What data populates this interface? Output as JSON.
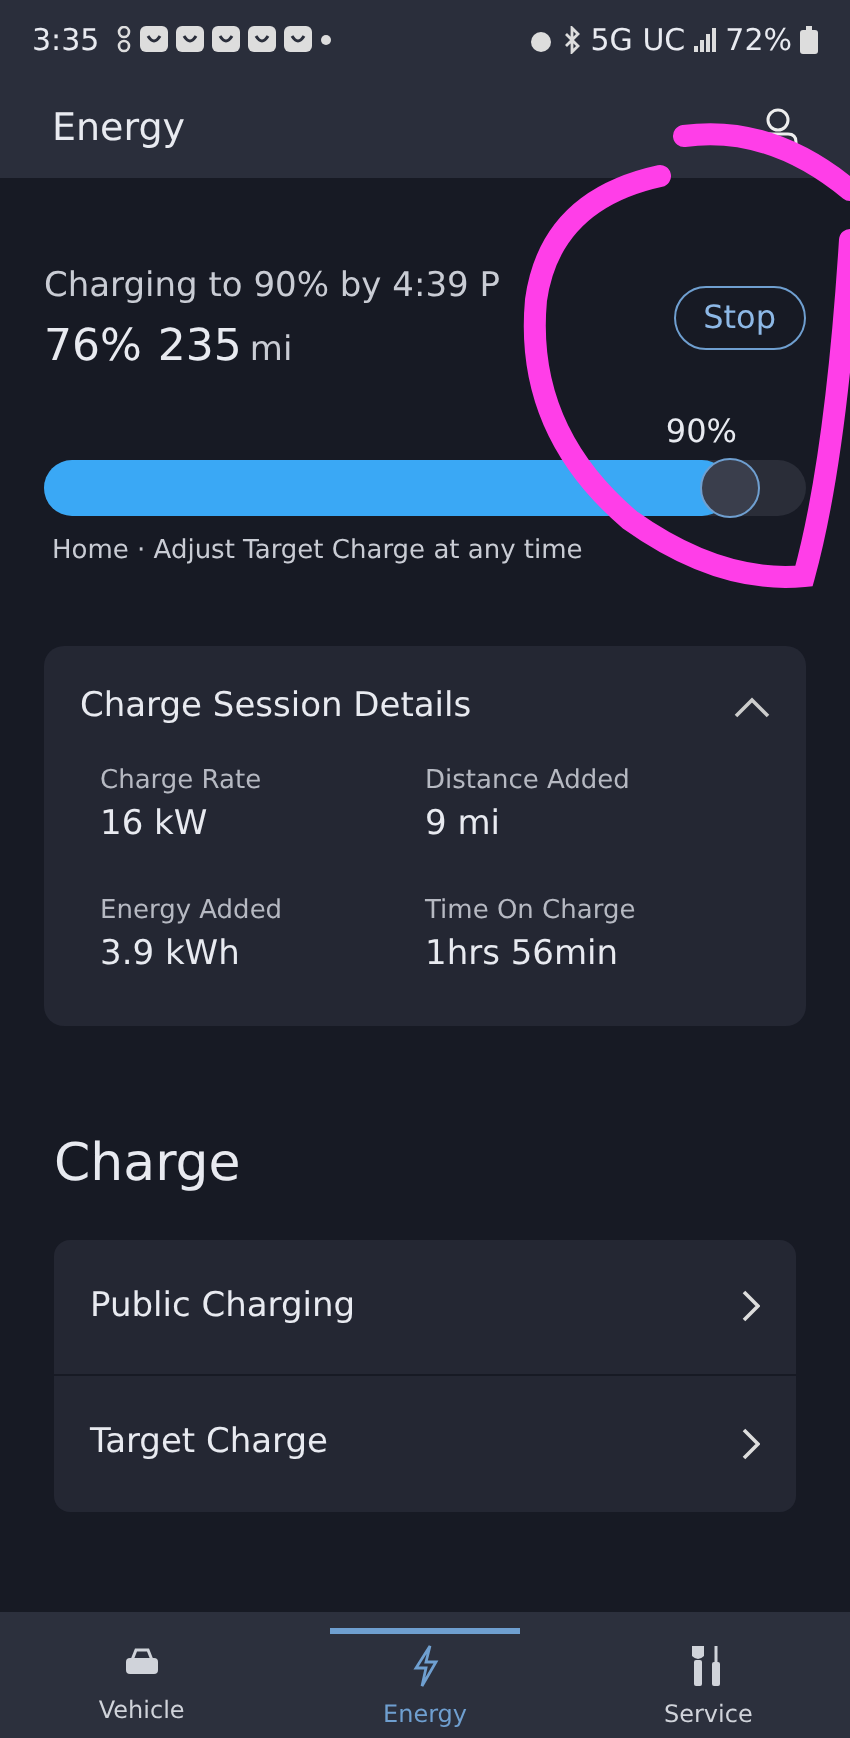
{
  "status_bar": {
    "time": "3:35",
    "network": "5G UC",
    "battery": "72%"
  },
  "header": {
    "title": "Energy"
  },
  "charging": {
    "status": "Charging to 90% by 4:39 P",
    "percent": "76%",
    "range": "235",
    "range_unit": "mi",
    "stop_button": "Stop",
    "target_label": "90%",
    "level": 0.9,
    "note": "Home · Adjust Target Charge at any time"
  },
  "session": {
    "title": "Charge Session Details",
    "expanded": true,
    "stats": [
      {
        "label": "Charge Rate",
        "value": "16 kW"
      },
      {
        "label": "Distance Added",
        "value": "9 mi"
      },
      {
        "label": "Energy Added",
        "value": "3.9 kWh"
      },
      {
        "label": "Time On Charge",
        "value": "1hrs 56min"
      }
    ]
  },
  "charge_section": {
    "title": "Charge",
    "items": [
      "Public Charging",
      "Target Charge"
    ]
  },
  "tabs": [
    {
      "label": "Vehicle",
      "kind": "car",
      "selected": false
    },
    {
      "label": "Energy",
      "kind": "bolt",
      "selected": true
    },
    {
      "label": "Service",
      "kind": "tools",
      "selected": false
    }
  ],
  "annotation": {
    "kind": "circle",
    "color": "#ff3ee8"
  }
}
